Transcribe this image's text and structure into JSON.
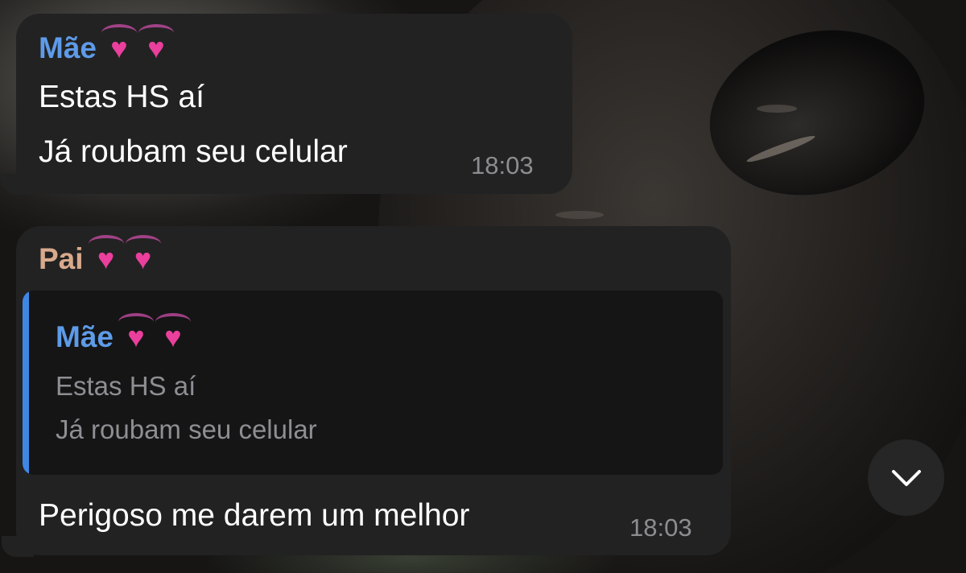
{
  "colors": {
    "bubble": "#222222",
    "accent_mae": "#5e9be8",
    "accent_pai": "#d9a98c",
    "reply_bar": "#3f87e5",
    "heart": "#ea3f9c"
  },
  "messages": [
    {
      "sender": "Mãe",
      "sender_icons": [
        "heart-icon",
        "heart-icon"
      ],
      "lines": [
        "Estas HS aí",
        "Já roubam seu celular"
      ],
      "time": "18:03"
    },
    {
      "sender": "Pai",
      "sender_icons": [
        "heart-icon",
        "heart-icon"
      ],
      "reply": {
        "sender": "Mãe",
        "lines": [
          "Estas HS aí",
          "Já roubam seu celular"
        ]
      },
      "lines": [
        "Perigoso me darem um melhor"
      ],
      "time": "18:03"
    }
  ],
  "scroll_button": {
    "icon": "chevron-down-icon"
  }
}
